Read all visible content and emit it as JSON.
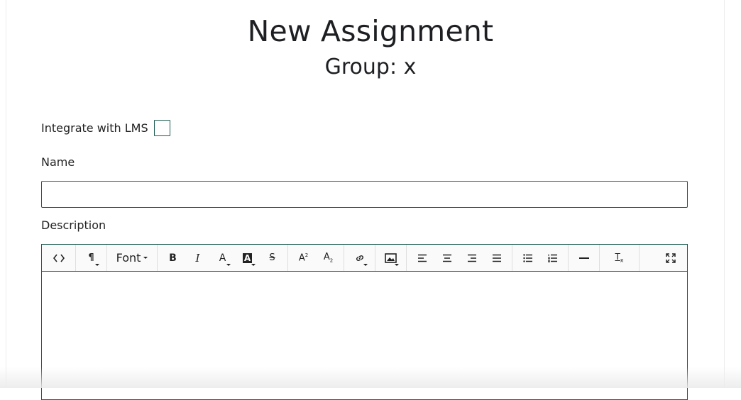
{
  "page": {
    "title": "New Assignment",
    "subtitle": "Group: x"
  },
  "form": {
    "lms_label": "Integrate with LMS",
    "lms_checked": false,
    "name_label": "Name",
    "name_value": "",
    "description_label": "Description",
    "description_value": ""
  },
  "toolbar": {
    "font_label": "Font",
    "buttons": [
      "code-view-icon",
      "paragraph-icon",
      "font-dropdown",
      "bold-icon",
      "italic-icon",
      "font-color-icon",
      "highlight-color-icon",
      "strikethrough-icon",
      "superscript-icon",
      "subscript-icon",
      "link-icon",
      "image-icon",
      "align-left-icon",
      "align-center-icon",
      "align-right-icon",
      "align-justify-icon",
      "bullet-list-icon",
      "numbered-list-icon",
      "horizontal-rule-icon",
      "clear-format-icon",
      "fullscreen-icon"
    ]
  },
  "colors": {
    "accent_border": "#1b5a50",
    "text": "#1d1f22"
  }
}
